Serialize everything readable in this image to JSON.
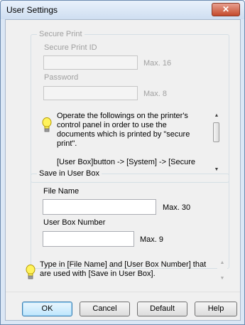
{
  "window": {
    "title": "User Settings",
    "close_glyph": "✕"
  },
  "secure_print": {
    "legend": "Secure Print",
    "id_label": "Secure Print ID",
    "id_value": "",
    "id_max": "Max. 16",
    "password_label": "Password",
    "password_value": "",
    "password_max": "Max. 8",
    "info_line1": "Operate the followings on the printer's control panel in order to use the documents which is printed by \"secure print\".",
    "info_line2": "[User Box]button -> [System] -> [Secure"
  },
  "save_box": {
    "legend": "Save in User Box",
    "file_name_label": "File Name",
    "file_name_value": "",
    "file_name_max": "Max. 30",
    "box_number_label": "User Box Number",
    "box_number_value": "",
    "box_number_max": "Max. 9"
  },
  "bottom_info": {
    "text": "Type in [File Name] and [User Box Number] that are used with [Save in User Box]."
  },
  "buttons": {
    "ok": "OK",
    "cancel": "Cancel",
    "default": "Default",
    "help": "Help"
  },
  "icons": {
    "info": "lightbulb-icon",
    "up": "scroll-up-icon",
    "down": "scroll-down-icon"
  }
}
